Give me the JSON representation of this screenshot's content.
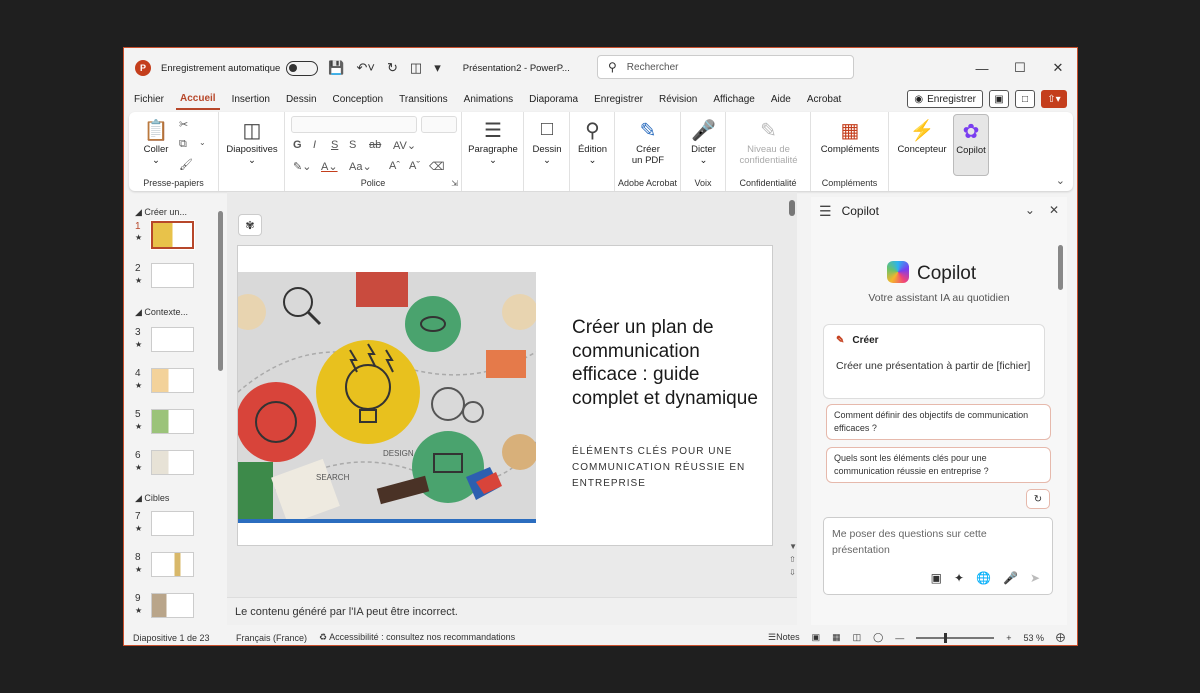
{
  "titlebar": {
    "app_icon": "P",
    "autosave_label": "Enregistrement automatique",
    "doc_title": "Présentation2 - PowerP...",
    "search_placeholder": "Rechercher"
  },
  "menu": {
    "tabs": [
      "Fichier",
      "Accueil",
      "Insertion",
      "Dessin",
      "Conception",
      "Transitions",
      "Animations",
      "Diaporama",
      "Enregistrer",
      "Révision",
      "Affichage",
      "Aide",
      "Acrobat"
    ],
    "active_tab": "Accueil",
    "record_button": "Enregistrer"
  },
  "ribbon": {
    "clipboard": {
      "paste": "Coller",
      "group": "Presse-papiers"
    },
    "slides": {
      "label": "Diapositives"
    },
    "font": {
      "group": "Police"
    },
    "paragraph": {
      "label": "Paragraphe"
    },
    "drawing": {
      "label": "Dessin"
    },
    "editing": {
      "label": "Édition"
    },
    "acrobat": {
      "label_line1": "Créer",
      "label_line2": "un PDF",
      "group": "Adobe Acrobat"
    },
    "voice": {
      "label": "Dicter",
      "group": "Voix"
    },
    "sensitivity": {
      "label_line1": "Niveau de",
      "label_line2": "confidentialité",
      "group": "Confidentialité"
    },
    "addins": {
      "label": "Compléments",
      "group": "Compléments"
    },
    "designer": {
      "label": "Concepteur"
    },
    "copilot": {
      "label": "Copilot"
    }
  },
  "thumbnails": {
    "sections": [
      {
        "title": "Créer un..."
      },
      {
        "title": "Contexte..."
      },
      {
        "title": "Cibles"
      }
    ],
    "slide_numbers": [
      "1",
      "2",
      "3",
      "4",
      "5",
      "6",
      "7",
      "8",
      "9"
    ],
    "star": "★"
  },
  "slide": {
    "title": "Créer un plan de communication efficace : guide complet et dynamique",
    "subtitle": "ÉLÉMENTS CLÉS POUR UNE COMMUNICATION RÉUSSIE EN ENTREPRISE",
    "image_labels": {
      "design": "DESIGN",
      "search": "SEARCH"
    }
  },
  "editor": {
    "disclaimer": "Le contenu généré par l'IA peut être incorrect."
  },
  "copilot": {
    "pane_title": "Copilot",
    "brand": "Copilot",
    "tagline": "Votre assistant IA au quotidien",
    "card_title": "Créer",
    "card_desc": "Créer une présentation à partir de [fichier]",
    "suggestion_1": "Comment définir des objectifs de communication efficaces ?",
    "suggestion_2": "Quels sont les éléments clés pour une communication réussie en entreprise ?",
    "input_placeholder": "Me poser des questions sur cette présentation"
  },
  "status": {
    "slide_counter": "Diapositive 1 de 23",
    "language": "Français (France)",
    "accessibility": "Accessibilité : consultez nos recommandations",
    "notes": "Notes",
    "zoom": "53 %"
  },
  "colors": {
    "accent": "#b7472a",
    "brand": "#c43e1c",
    "slide_bar": "#2b6dbf"
  }
}
